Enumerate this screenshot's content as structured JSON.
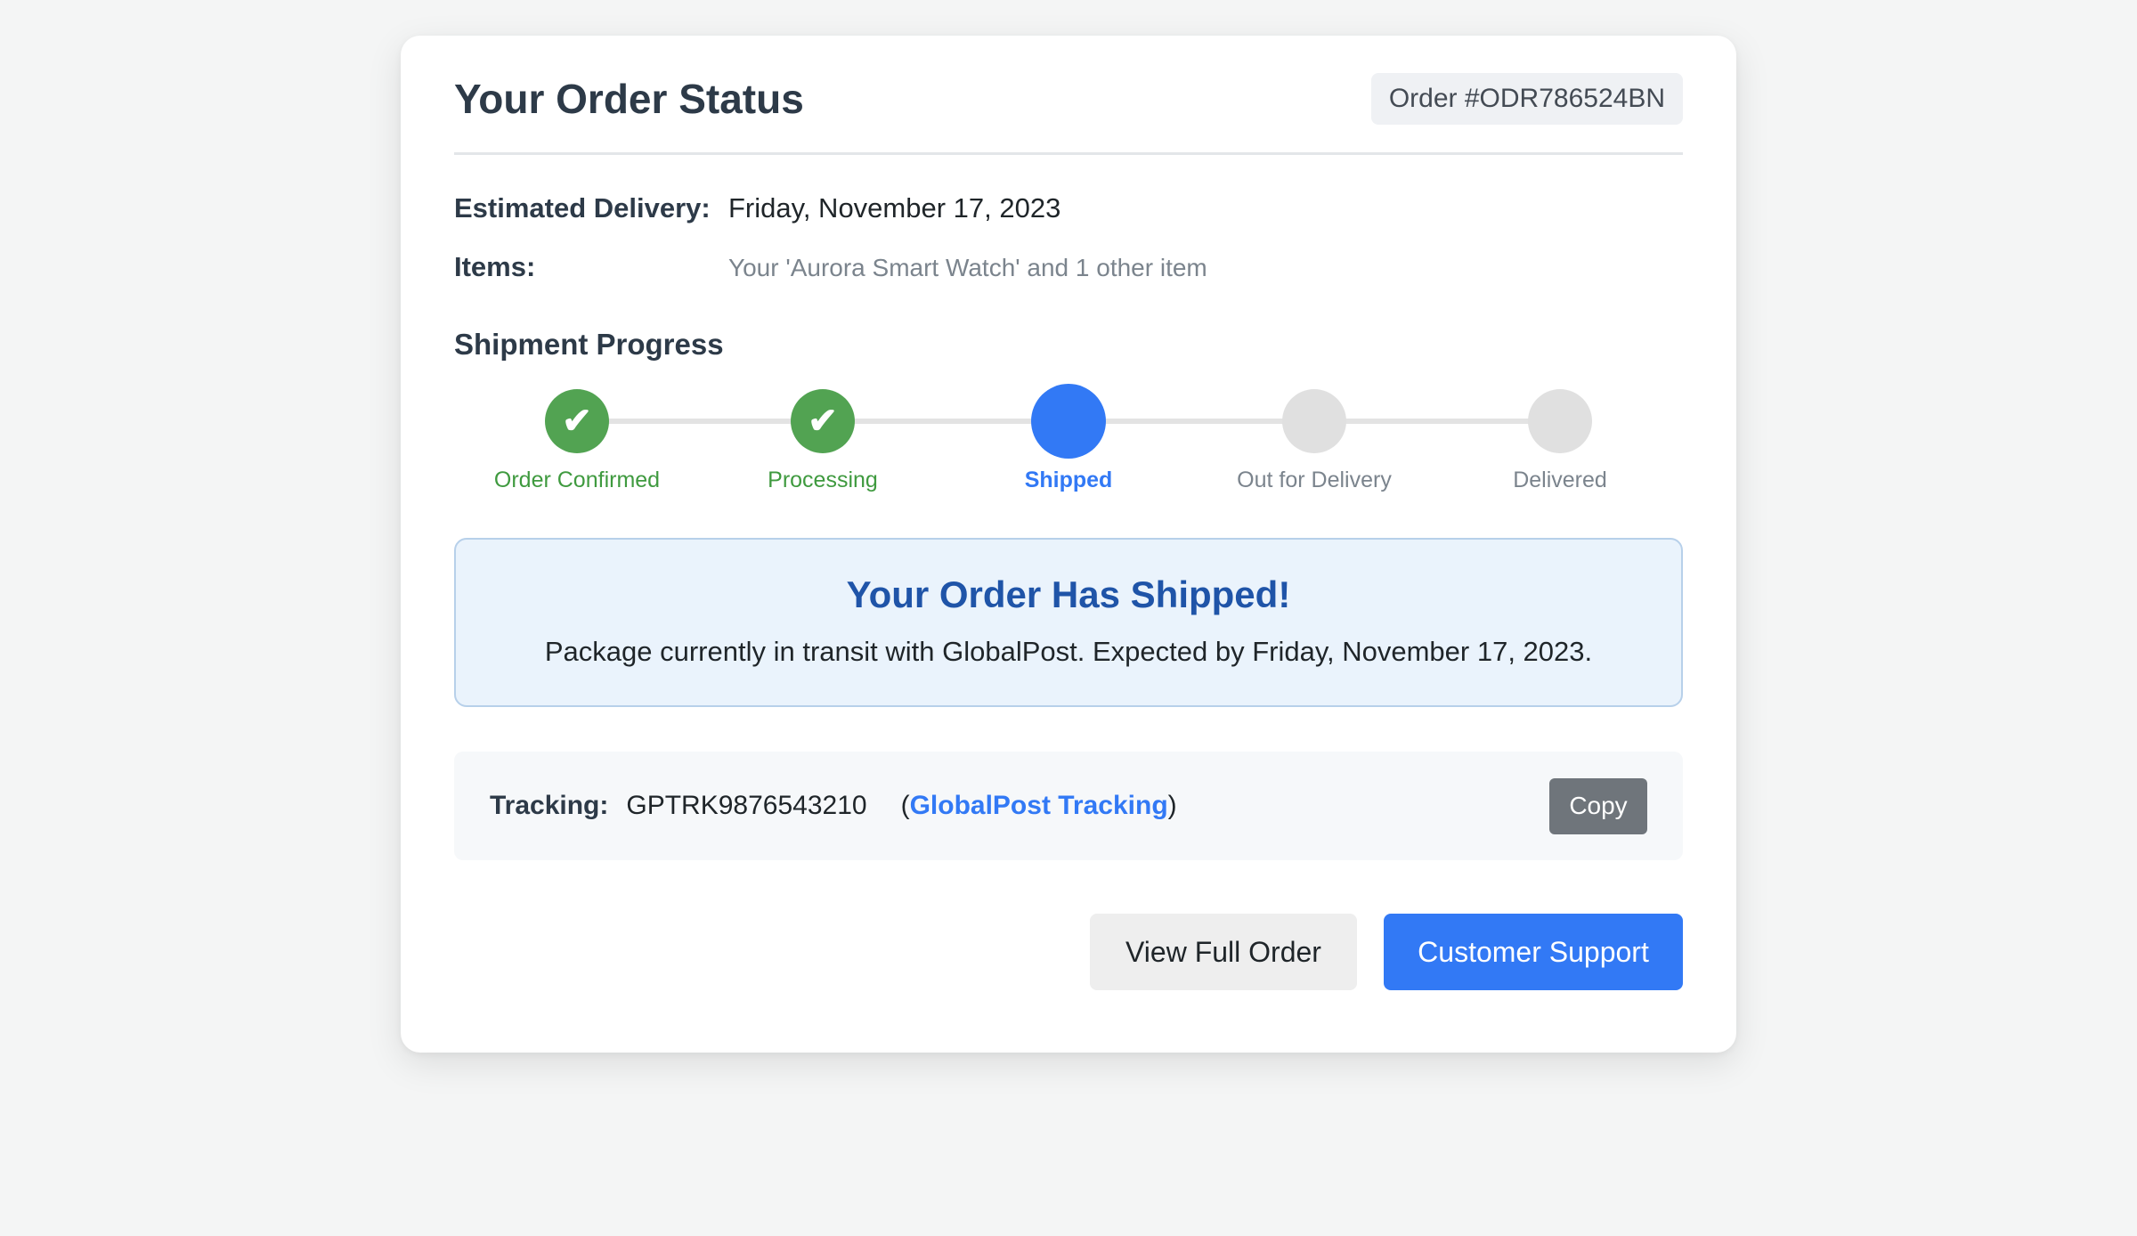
{
  "header": {
    "title": "Your Order Status",
    "order_badge": "Order #ODR786524BN"
  },
  "details": {
    "delivery_label": "Estimated Delivery:",
    "delivery_value": "Friday, November 17, 2023",
    "items_label": "Items:",
    "items_value": "Your 'Aurora Smart Watch' and 1 other item"
  },
  "progress": {
    "title": "Shipment Progress",
    "steps": [
      {
        "label": "Order Confirmed",
        "state": "done",
        "icon": "check-icon",
        "glyph": "✔"
      },
      {
        "label": "Processing",
        "state": "done",
        "icon": "check-icon",
        "glyph": "✔"
      },
      {
        "label": "Shipped",
        "state": "active"
      },
      {
        "label": "Out for Delivery",
        "state": "pending"
      },
      {
        "label": "Delivered",
        "state": "pending"
      }
    ]
  },
  "alert": {
    "title": "Your Order Has Shipped!",
    "message": "Package currently in transit with GlobalPost. Expected by Friday, November 17, 2023."
  },
  "tracking": {
    "label": "Tracking:",
    "number": "GPTRK9876543210",
    "open_paren": "(",
    "link_label": "GlobalPost Tracking",
    "close_paren": ")",
    "copy_label": "Copy"
  },
  "actions": {
    "view_order_label": "View Full Order",
    "support_label": "Customer Support"
  },
  "colors": {
    "accent": "#3279f5",
    "success": "#52a352",
    "pending": "#e0e0e0",
    "alert_background": "#eaf3fc",
    "alert_title": "#1f54a8"
  }
}
